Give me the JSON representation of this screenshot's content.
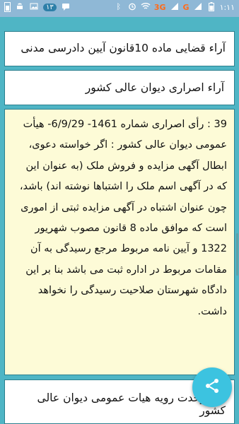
{
  "status_bar": {
    "time": "۱:۱۱",
    "network_label": "3G",
    "carrier_label": "G",
    "notification_count": "۱۳"
  },
  "list": {
    "item1": "آراء قضایی ماده 10قانون آیین دادرسی مدنی",
    "item2": "آراء اصراری دیوان عالی کشور",
    "content_lines": [
      "39 : رأی اصراری شماره 1461- 6/9/29- هیأت",
      "عمومی دیوان عالی کشور :   اگر خواسته دعوی،",
      "ابطال آگهی مزایده و فروش ملک (به عنوان این",
      "که در آگهی اسم ملک را اشتباها نوشته اند) باشد،",
      "چون عنوان اشتباه در آگهی مزایده ثبتی از اموری",
      "است که موافق ماده 8 قانون مصوب شهریور",
      "1322 و آیین نامه مربوط مرجع رسیدگی به آن",
      "مقامات مربوط در اداره ثبت می باشد بنا بر این",
      "دادگاه شهرستان صلاحیت رسیدگی را نخواهد",
      "داشت."
    ],
    "item3": "آراء وحدت رویه هیات عمومی دیوان عالی کشور"
  },
  "colors": {
    "background": "#4fb5c5",
    "content_bg": "#fdfbd7",
    "share_button": "#3cc3e0"
  },
  "icons": {
    "share": "share-icon"
  }
}
